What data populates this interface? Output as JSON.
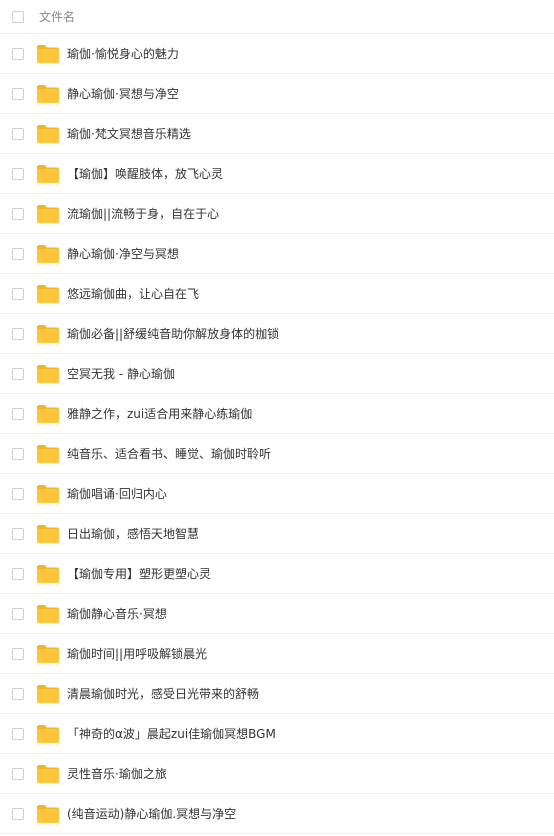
{
  "header": {
    "column_label": "文件名"
  },
  "colors": {
    "folder": "#ffc53d",
    "folder_tab": "#f5b525",
    "text": "#333333",
    "muted": "#888888"
  },
  "items": [
    {
      "name": "瑜伽·愉悦身心的魅力",
      "icon": "folder-icon"
    },
    {
      "name": "静心瑜伽·冥想与净空",
      "icon": "folder-icon"
    },
    {
      "name": "瑜伽·梵文冥想音乐精选",
      "icon": "folder-icon"
    },
    {
      "name": "【瑜伽】唤醒肢体，放飞心灵",
      "icon": "folder-icon"
    },
    {
      "name": "流瑜伽||流畅于身，自在于心",
      "icon": "folder-icon"
    },
    {
      "name": "静心瑜伽·净空与冥想",
      "icon": "folder-icon"
    },
    {
      "name": "悠远瑜伽曲，让心自在飞",
      "icon": "folder-icon"
    },
    {
      "name": "瑜伽必备||舒缓纯音助你解放身体的枷锁",
      "icon": "folder-icon"
    },
    {
      "name": "空冥无我 - 静心瑜伽",
      "icon": "folder-icon"
    },
    {
      "name": "雅静之作，zui适合用来静心练瑜伽",
      "icon": "folder-icon"
    },
    {
      "name": "纯音乐、适合看书、睡觉、瑜伽时聆听",
      "icon": "folder-icon"
    },
    {
      "name": "瑜伽唱诵·回归内心",
      "icon": "folder-icon"
    },
    {
      "name": "日出瑜伽，感悟天地智慧",
      "icon": "folder-icon"
    },
    {
      "name": "【瑜伽专用】塑形更塑心灵",
      "icon": "folder-icon"
    },
    {
      "name": "瑜伽静心音乐·冥想",
      "icon": "folder-icon"
    },
    {
      "name": "瑜伽时间||用呼吸解锁晨光",
      "icon": "folder-icon"
    },
    {
      "name": "清晨瑜伽时光，感受日光带来的舒畅",
      "icon": "folder-icon"
    },
    {
      "name": "「神奇的α波」晨起zui佳瑜伽冥想BGM",
      "icon": "folder-icon"
    },
    {
      "name": "灵性音乐·瑜伽之旅",
      "icon": "folder-icon"
    },
    {
      "name": "(纯音运动)静心瑜伽.冥想与净空",
      "icon": "folder-icon"
    }
  ]
}
